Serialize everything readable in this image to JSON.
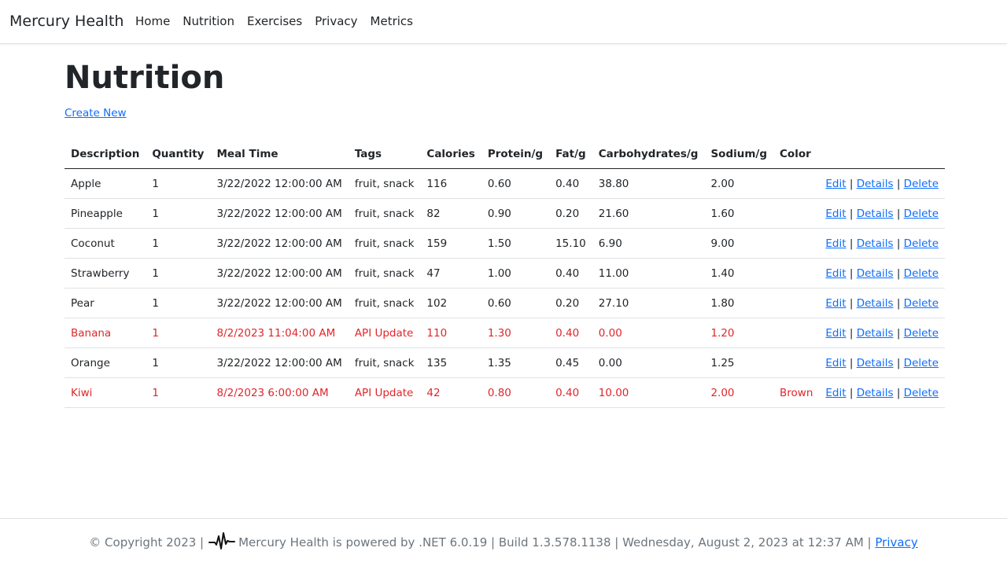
{
  "header": {
    "brand": "Mercury Health",
    "nav": [
      "Home",
      "Nutrition",
      "Exercises",
      "Privacy",
      "Metrics"
    ]
  },
  "main": {
    "title": "Nutrition",
    "create_new": "Create New",
    "columns": [
      "Description",
      "Quantity",
      "Meal Time",
      "Tags",
      "Calories",
      "Protein/g",
      "Fat/g",
      "Carbohydrates/g",
      "Sodium/g",
      "Color"
    ],
    "actions": {
      "edit": "Edit",
      "details": "Details",
      "delete": "Delete",
      "sep": "|"
    },
    "rows": [
      {
        "description": "Apple",
        "quantity": "1",
        "meal_time": "3/22/2022 12:00:00 AM",
        "tags": "fruit, snack",
        "calories": "116",
        "protein": "0.60",
        "fat": "0.40",
        "carbs": "38.80",
        "sodium": "2.00",
        "color": "",
        "highlight": false
      },
      {
        "description": "Pineapple",
        "quantity": "1",
        "meal_time": "3/22/2022 12:00:00 AM",
        "tags": "fruit, snack",
        "calories": "82",
        "protein": "0.90",
        "fat": "0.20",
        "carbs": "21.60",
        "sodium": "1.60",
        "color": "",
        "highlight": false
      },
      {
        "description": "Coconut",
        "quantity": "1",
        "meal_time": "3/22/2022 12:00:00 AM",
        "tags": "fruit, snack",
        "calories": "159",
        "protein": "1.50",
        "fat": "15.10",
        "carbs": "6.90",
        "sodium": "9.00",
        "color": "",
        "highlight": false
      },
      {
        "description": "Strawberry",
        "quantity": "1",
        "meal_time": "3/22/2022 12:00:00 AM",
        "tags": "fruit, snack",
        "calories": "47",
        "protein": "1.00",
        "fat": "0.40",
        "carbs": "11.00",
        "sodium": "1.40",
        "color": "",
        "highlight": false
      },
      {
        "description": "Pear",
        "quantity": "1",
        "meal_time": "3/22/2022 12:00:00 AM",
        "tags": "fruit, snack",
        "calories": "102",
        "protein": "0.60",
        "fat": "0.20",
        "carbs": "27.10",
        "sodium": "1.80",
        "color": "",
        "highlight": false
      },
      {
        "description": "Banana",
        "quantity": "1",
        "meal_time": "8/2/2023 11:04:00 AM",
        "tags": "API Update",
        "calories": "110",
        "protein": "1.30",
        "fat": "0.40",
        "carbs": "0.00",
        "sodium": "1.20",
        "color": "",
        "highlight": true
      },
      {
        "description": "Orange",
        "quantity": "1",
        "meal_time": "3/22/2022 12:00:00 AM",
        "tags": "fruit, snack",
        "calories": "135",
        "protein": "1.35",
        "fat": "0.45",
        "carbs": "0.00",
        "sodium": "1.25",
        "color": "",
        "highlight": false
      },
      {
        "description": "Kiwi",
        "quantity": "1",
        "meal_time": "8/2/2023 6:00:00 AM",
        "tags": "API Update",
        "calories": "42",
        "protein": "0.80",
        "fat": "0.40",
        "carbs": "10.00",
        "sodium": "2.00",
        "color": "Brown",
        "highlight": true
      }
    ]
  },
  "footer": {
    "copyright": "© Copyright 2023 |",
    "powered": "Mercury Health is powered by .NET 6.0.19 | Build 1.3.578.1138 | Wednesday, August 2, 2023 at 12:37 AM |",
    "privacy": "Privacy",
    "logo_icon": "heartbeat-icon"
  },
  "colors": {
    "highlight_text": "#e0262b",
    "link": "#0d6efd"
  }
}
